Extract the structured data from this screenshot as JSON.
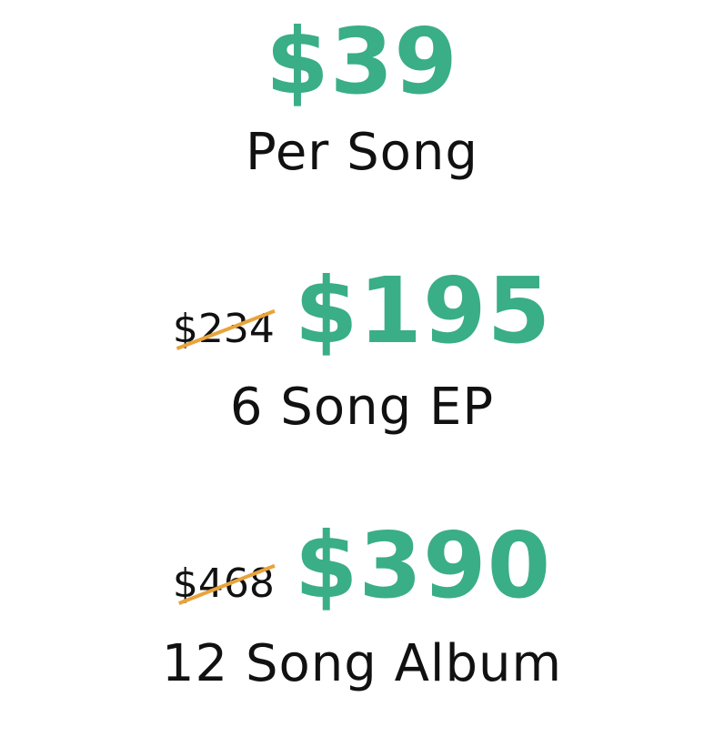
{
  "colors": {
    "accent_green": "#3aae86",
    "strike_orange": "#e9a33b",
    "text": "#111111"
  },
  "tiers": [
    {
      "price": "$39",
      "label": "Per Song"
    },
    {
      "old_price": "$234",
      "price": "$195",
      "label": "6 Song EP"
    },
    {
      "old_price": "$468",
      "price": "$390",
      "label": "12 Song Album"
    }
  ]
}
